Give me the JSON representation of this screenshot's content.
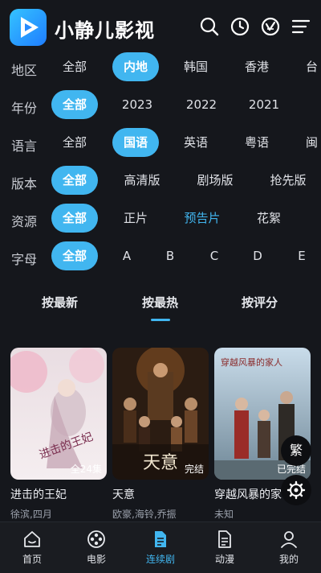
{
  "app": {
    "title": "小静儿影视"
  },
  "header_icons": [
    "search-icon",
    "history-icon",
    "vip-icon",
    "menu-icon"
  ],
  "filters": [
    {
      "label": "地区",
      "options": [
        "全部",
        "内地",
        "韩国",
        "香港",
        "台"
      ],
      "selected": 1
    },
    {
      "label": "年份",
      "options": [
        "全部",
        "2023",
        "2022",
        "2021"
      ],
      "selected": 0
    },
    {
      "label": "语言",
      "options": [
        "全部",
        "国语",
        "英语",
        "粤语",
        "闽"
      ],
      "selected": 1
    },
    {
      "label": "版本",
      "options": [
        "全部",
        "高清版",
        "剧场版",
        "抢先版"
      ],
      "selected": 0
    },
    {
      "label": "资源",
      "options": [
        "全部",
        "正片",
        "预告片",
        "花絮"
      ],
      "selected": 0
    },
    {
      "label": "字母",
      "options": [
        "全部",
        "A",
        "B",
        "C",
        "D",
        "E"
      ],
      "selected": 0
    }
  ],
  "sort_tabs": {
    "items": [
      "按最新",
      "按最热",
      "按评分"
    ],
    "selected": 1
  },
  "cards": [
    {
      "title": "进击的王妃",
      "subtitle": "徐滨,四月",
      "badge": "全24集",
      "poster_text": "进击的王妃"
    },
    {
      "title": "天意",
      "subtitle": "欧豪,海铃,乔振",
      "badge": "完结",
      "poster_text": "天意"
    },
    {
      "title": "穿越风暴的家",
      "subtitle": "未知",
      "badge": "已完结",
      "poster_text": "穿越风暴的家人"
    }
  ],
  "floating": {
    "traditional_label": "繁"
  },
  "bottom_nav": {
    "items": [
      {
        "label": "首页",
        "icon": "home-icon"
      },
      {
        "label": "电影",
        "icon": "film-reel-icon"
      },
      {
        "label": "连续剧",
        "icon": "document-icon"
      },
      {
        "label": "动漫",
        "icon": "document-icon"
      },
      {
        "label": "我的",
        "icon": "user-icon"
      }
    ],
    "selected": 2
  },
  "colors": {
    "accent": "#41b6f0",
    "background": "#15171c",
    "nav_background": "#1a1c21"
  }
}
